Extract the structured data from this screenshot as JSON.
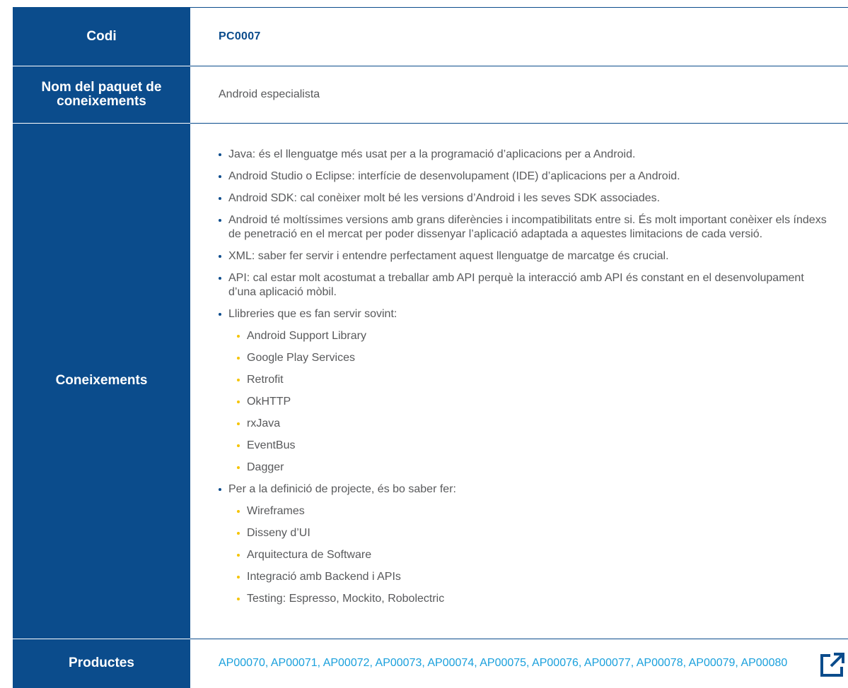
{
  "rows": {
    "code": {
      "label": "Codi",
      "value": "PC0007"
    },
    "name": {
      "label_line1": "Nom del paquet de",
      "label_line2": "coneixements",
      "value": "Android especialista"
    },
    "knowledge": {
      "label": "Coneixements",
      "items": [
        "Java: és el llenguatge més usat per a la programació d’aplicacions per a Android.",
        "Android Studio o Eclipse: interfície de desenvolupament (IDE) d’aplicacions per a Android.",
        "Android SDK: cal conèixer molt bé les versions d’Android i les seves SDK associades.",
        "Android té moltíssimes versions amb grans diferències i incompatibilitats entre si. És molt important conèixer els índexs de penetració en el mercat per poder dissenyar l’aplicació adaptada a aquestes limitacions de cada versió.",
        "XML: saber fer servir i entendre perfectament aquest llenguatge de marcatge és crucial.",
        "API: cal estar molt acostumat a treballar amb API perquè la interacció amb API és constant en el desenvolupament d’una aplicació mòbil.",
        "Llibreries que es fan servir sovint:",
        "Per a la definició de projecte, és bo saber fer:"
      ],
      "libraries": [
        "Android Support Library",
        "Google Play Services",
        "Retrofit",
        "OkHTTP",
        "rxJava",
        "EventBus",
        "Dagger"
      ],
      "project_skills": [
        "Wireframes",
        "Disseny d’UI",
        "Arquitectura de Software",
        "Integració amb Backend i APIs",
        "Testing: Espresso, Mockito, Robolectric"
      ]
    },
    "products": {
      "label": "Productes",
      "value": "AP00070, AP00071, AP00072, AP00073, AP00074, AP00075, AP00076, AP00077, AP00078, AP00079, AP00080",
      "icon": "external-link-icon"
    }
  },
  "colors": {
    "header_blue": "#0b4c8c",
    "text_gray": "#58595b",
    "link_blue": "#1aa0dc",
    "sub_bullet_yellow": "#f5c400"
  }
}
